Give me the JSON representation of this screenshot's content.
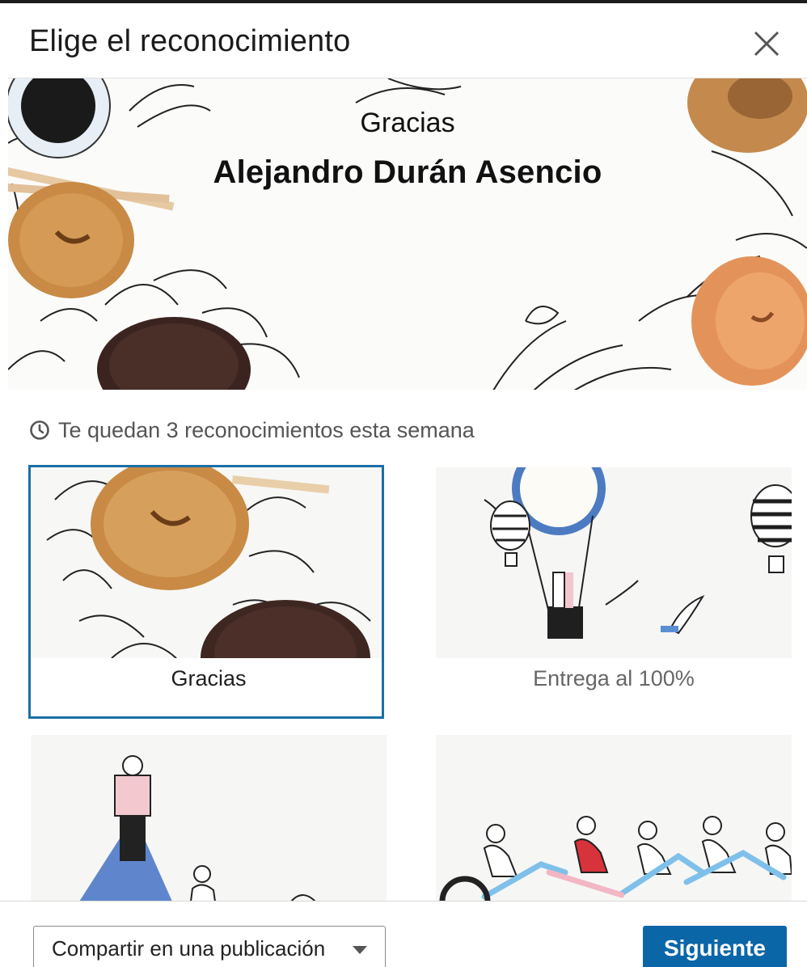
{
  "dialog": {
    "title": "Elige el reconocimiento",
    "close_icon": "close-icon"
  },
  "hero": {
    "kudos_type": "Gracias",
    "recipient_name": "Alejandro Durán Asencio"
  },
  "quota": {
    "icon": "clock-icon",
    "text": "Te quedan 3 reconocimientos esta semana"
  },
  "cards": [
    {
      "label": "Gracias",
      "selected": true
    },
    {
      "label": "Entrega al 100%",
      "selected": false
    },
    {
      "label": "",
      "selected": false
    },
    {
      "label": "",
      "selected": false
    }
  ],
  "footer": {
    "share_label": "Compartir en una publicación",
    "next_label": "Siguiente"
  },
  "colors": {
    "accent": "#0b66a8",
    "selected_border": "#1a6fa6"
  }
}
